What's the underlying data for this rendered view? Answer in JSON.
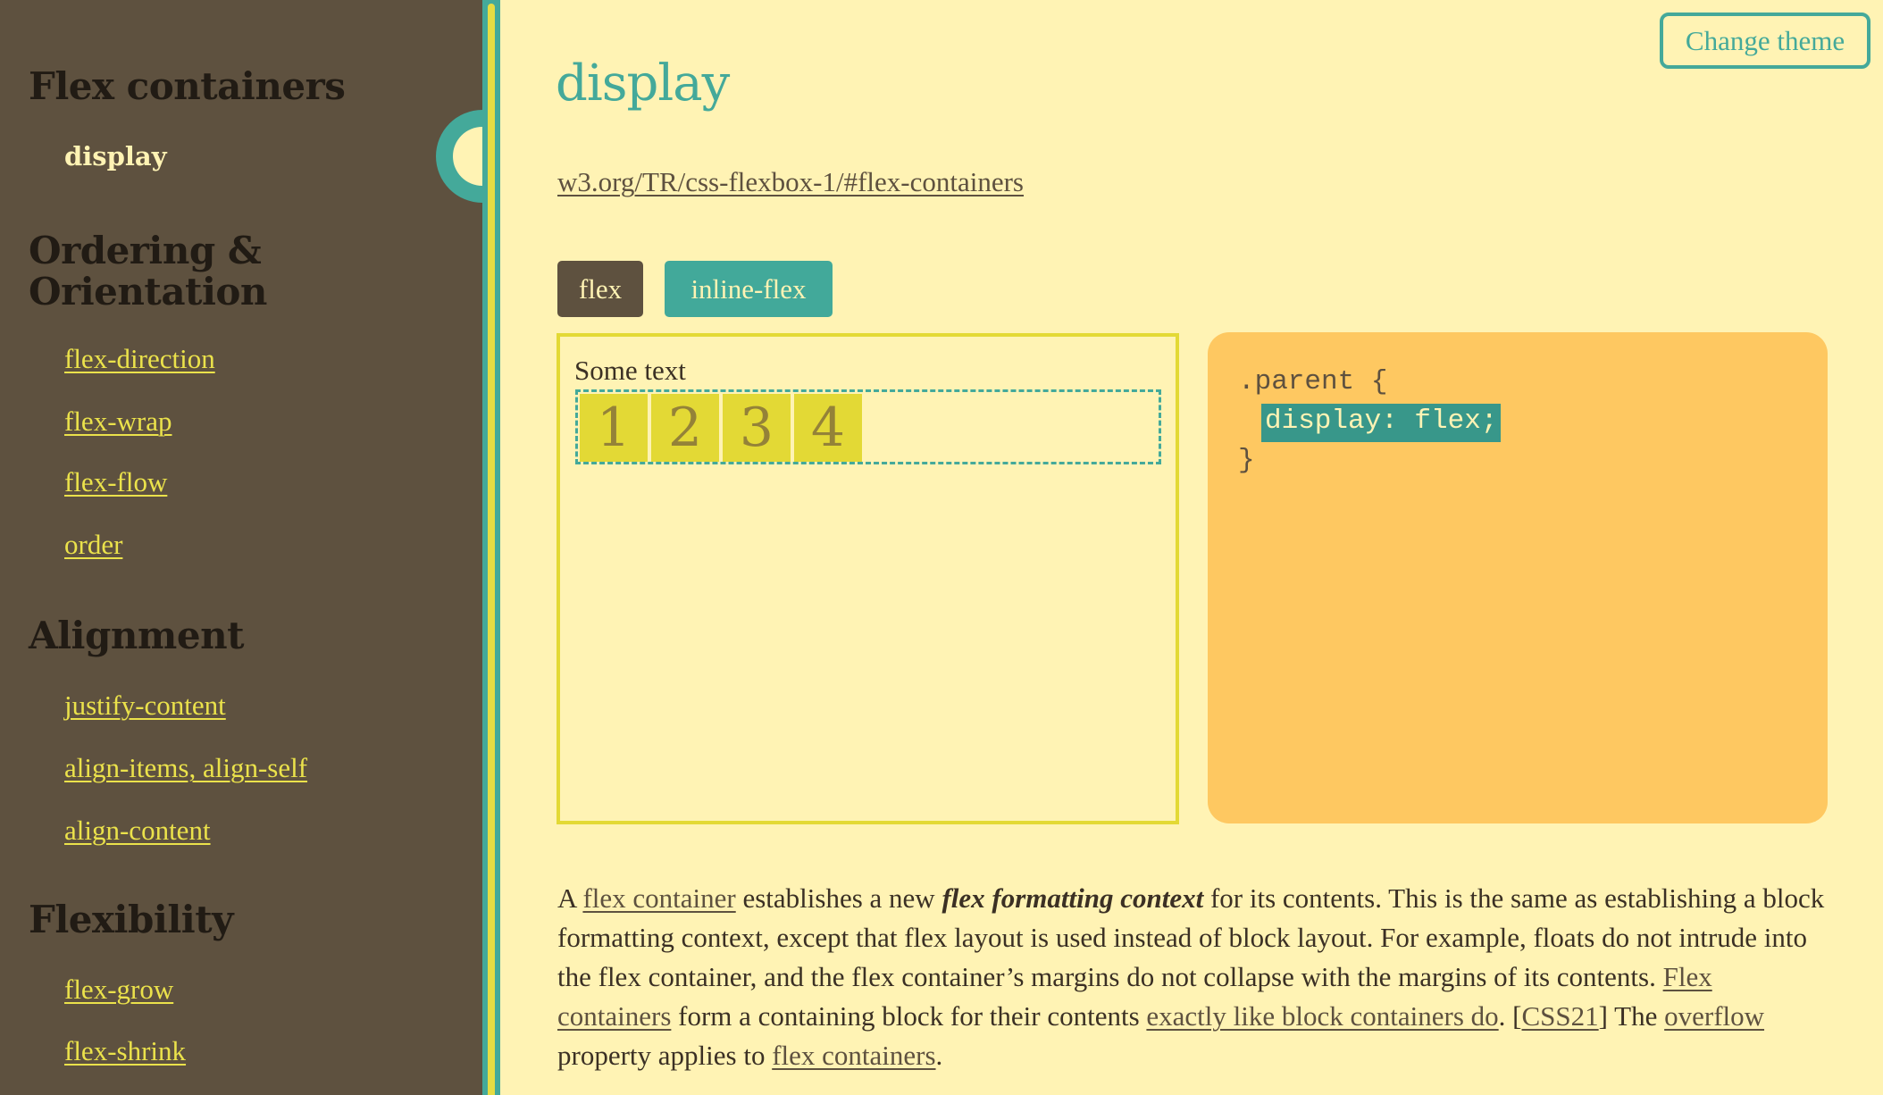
{
  "sidebar": {
    "sections": [
      {
        "heading": "Flex containers",
        "items": [
          {
            "label": "display",
            "active": true
          }
        ]
      },
      {
        "heading": "Ordering & Orientation",
        "items": [
          {
            "label": "flex-direction"
          },
          {
            "label": "flex-wrap"
          },
          {
            "label": "flex-flow"
          },
          {
            "label": "order"
          }
        ]
      },
      {
        "heading": "Alignment",
        "items": [
          {
            "label": "justify-content"
          },
          {
            "label": "align-items, align-self"
          },
          {
            "label": "align-content"
          }
        ]
      },
      {
        "heading": "Flexibility",
        "items": [
          {
            "label": "flex-grow"
          },
          {
            "label": "flex-shrink"
          }
        ]
      }
    ]
  },
  "header": {
    "theme_button": "Change theme"
  },
  "main": {
    "title": "display",
    "spec_link": "w3.org/TR/css-flexbox-1/#flex-containers",
    "toggles": [
      {
        "label": "flex",
        "selected": true
      },
      {
        "label": "inline-flex",
        "selected": false
      }
    ],
    "demo": {
      "text": "Some text",
      "items": [
        "1",
        "2",
        "3",
        "4"
      ]
    },
    "code": {
      "selector_line": ".parent {",
      "declaration": "display: flex;",
      "closing": "}"
    },
    "description": {
      "t1": "A ",
      "l1": "flex container",
      "t2": " establishes a new ",
      "em": "flex formatting context",
      "t3": " for its contents. This is the same as establishing a block formatting context, except that flex layout is used instead of block layout. For example, floats do not intrude into the flex container, and the flex container’s margins do not collapse with the margins of its contents. ",
      "l2": "Flex containers",
      "t4": " form a containing block for their contents ",
      "l3": "exactly like block containers do",
      "t5": ". [",
      "l4": "CSS21",
      "t6": "] The ",
      "l5": "overflow",
      "t7": " property applies to ",
      "l6": "flex containers",
      "t8": "."
    }
  },
  "colors": {
    "sidebar_bg": "#5e513f",
    "page_bg": "#fff3b4",
    "accent_teal": "#44a99a",
    "accent_yellow": "#e3d935",
    "code_bg": "#fec861",
    "nav_link": "#ebe24b"
  }
}
